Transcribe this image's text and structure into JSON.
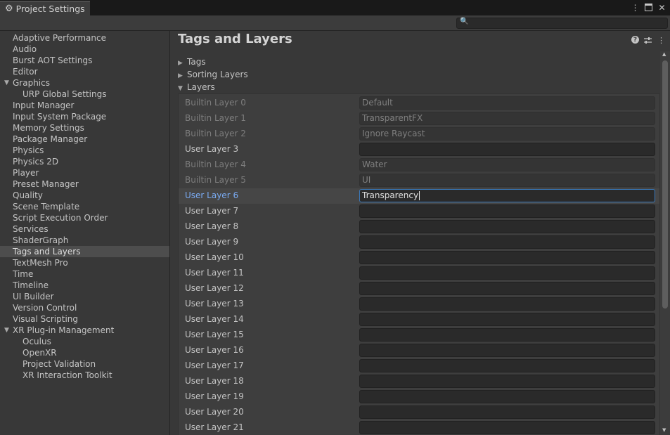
{
  "window": {
    "tab_title": "Project Settings",
    "tab_icon": "gear-icon",
    "window_buttons": [
      "more-icon",
      "maximize-icon",
      "close-icon"
    ],
    "search": {
      "placeholder": "",
      "value": ""
    }
  },
  "sidebar": {
    "items": [
      {
        "label": "Adaptive Performance",
        "indent": 0
      },
      {
        "label": "Audio",
        "indent": 0
      },
      {
        "label": "Burst AOT Settings",
        "indent": 0
      },
      {
        "label": "Editor",
        "indent": 0
      },
      {
        "label": "Graphics",
        "indent": 0,
        "foldout": "expanded"
      },
      {
        "label": "URP Global Settings",
        "indent": 1
      },
      {
        "label": "Input Manager",
        "indent": 0
      },
      {
        "label": "Input System Package",
        "indent": 0
      },
      {
        "label": "Memory Settings",
        "indent": 0
      },
      {
        "label": "Package Manager",
        "indent": 0
      },
      {
        "label": "Physics",
        "indent": 0
      },
      {
        "label": "Physics 2D",
        "indent": 0
      },
      {
        "label": "Player",
        "indent": 0
      },
      {
        "label": "Preset Manager",
        "indent": 0
      },
      {
        "label": "Quality",
        "indent": 0
      },
      {
        "label": "Scene Template",
        "indent": 0
      },
      {
        "label": "Script Execution Order",
        "indent": 0
      },
      {
        "label": "Services",
        "indent": 0
      },
      {
        "label": "ShaderGraph",
        "indent": 0
      },
      {
        "label": "Tags and Layers",
        "indent": 0,
        "selected": true
      },
      {
        "label": "TextMesh Pro",
        "indent": 0
      },
      {
        "label": "Time",
        "indent": 0
      },
      {
        "label": "Timeline",
        "indent": 0
      },
      {
        "label": "UI Builder",
        "indent": 0
      },
      {
        "label": "Version Control",
        "indent": 0
      },
      {
        "label": "Visual Scripting",
        "indent": 0
      },
      {
        "label": "XR Plug-in Management",
        "indent": 0,
        "foldout": "expanded"
      },
      {
        "label": "Oculus",
        "indent": 1
      },
      {
        "label": "OpenXR",
        "indent": 1
      },
      {
        "label": "Project Validation",
        "indent": 1
      },
      {
        "label": "XR Interaction Toolkit",
        "indent": 1
      }
    ]
  },
  "main": {
    "title": "Tags and Layers",
    "header_icons": [
      "help-icon",
      "settings-sliders-icon",
      "more-icon"
    ],
    "sections": [
      {
        "label": "Tags",
        "expanded": false
      },
      {
        "label": "Sorting Layers",
        "expanded": false
      },
      {
        "label": "Layers",
        "expanded": true
      }
    ],
    "layers": [
      {
        "name": "Builtin Layer 0",
        "value": "Default",
        "builtin": true
      },
      {
        "name": "Builtin Layer 1",
        "value": "TransparentFX",
        "builtin": true
      },
      {
        "name": "Builtin Layer 2",
        "value": "Ignore Raycast",
        "builtin": true
      },
      {
        "name": "User Layer 3",
        "value": "",
        "builtin": false
      },
      {
        "name": "Builtin Layer 4",
        "value": "Water",
        "builtin": true
      },
      {
        "name": "Builtin Layer 5",
        "value": "UI",
        "builtin": true
      },
      {
        "name": "User Layer 6",
        "value": "Transparency",
        "builtin": false,
        "focused": true
      },
      {
        "name": "User Layer 7",
        "value": "",
        "builtin": false
      },
      {
        "name": "User Layer 8",
        "value": "",
        "builtin": false
      },
      {
        "name": "User Layer 9",
        "value": "",
        "builtin": false
      },
      {
        "name": "User Layer 10",
        "value": "",
        "builtin": false
      },
      {
        "name": "User Layer 11",
        "value": "",
        "builtin": false
      },
      {
        "name": "User Layer 12",
        "value": "",
        "builtin": false
      },
      {
        "name": "User Layer 13",
        "value": "",
        "builtin": false
      },
      {
        "name": "User Layer 14",
        "value": "",
        "builtin": false
      },
      {
        "name": "User Layer 15",
        "value": "",
        "builtin": false
      },
      {
        "name": "User Layer 16",
        "value": "",
        "builtin": false
      },
      {
        "name": "User Layer 17",
        "value": "",
        "builtin": false
      },
      {
        "name": "User Layer 18",
        "value": "",
        "builtin": false
      },
      {
        "name": "User Layer 19",
        "value": "",
        "builtin": false
      },
      {
        "name": "User Layer 20",
        "value": "",
        "builtin": false
      },
      {
        "name": "User Layer 21",
        "value": "",
        "builtin": false
      }
    ]
  },
  "colors": {
    "background": "#383838",
    "tab_strip": "#191919",
    "focus_highlight": "#7aabf3",
    "focus_border": "#3a79bb",
    "selected_item": "#4d4d4d"
  }
}
